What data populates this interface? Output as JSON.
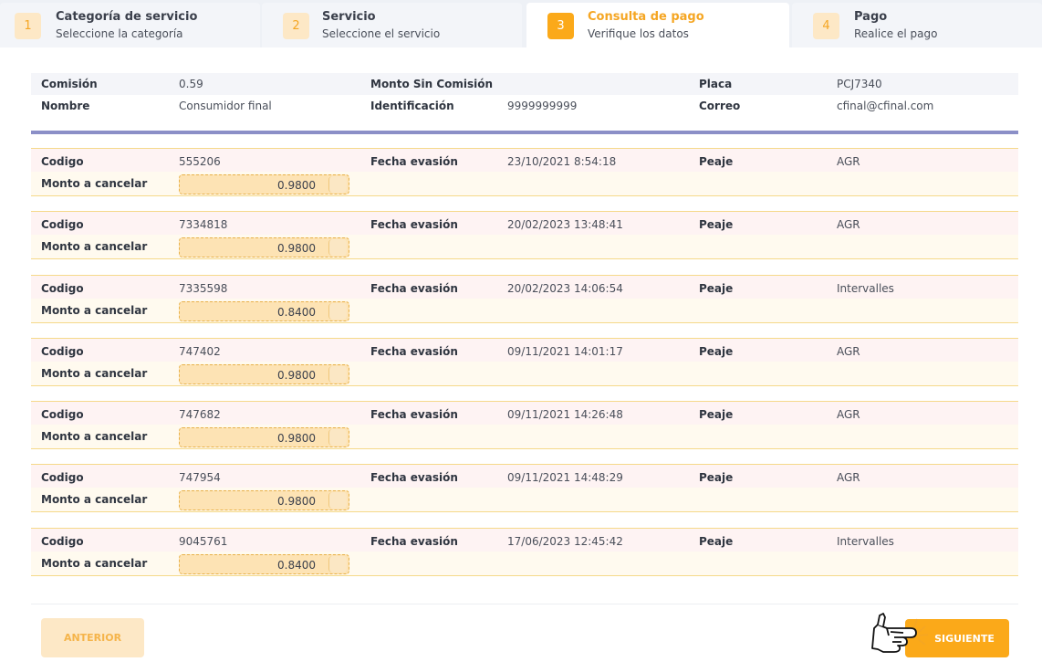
{
  "stepper": [
    {
      "number": "1",
      "title": "Categoría de servicio",
      "subtitle": "Seleccione la categoría"
    },
    {
      "number": "2",
      "title": "Servicio",
      "subtitle": "Seleccione el servicio"
    },
    {
      "number": "3",
      "title": "Consulta de pago",
      "subtitle": "Verifique los datos"
    },
    {
      "number": "4",
      "title": "Pago",
      "subtitle": "Realice el pago"
    }
  ],
  "summary": {
    "comision_label": "Comisión",
    "comision_value": "0.59",
    "monto_sin_label": "Monto Sin Comisión",
    "monto_sin_value": "",
    "placa_label": "Placa",
    "placa_value": "PCJ7340",
    "nombre_label": "Nombre",
    "nombre_value": "Consumidor final",
    "identificacion_label": "Identificación",
    "identificacion_value": "9999999999",
    "correo_label": "Correo",
    "correo_value": "cfinal@cfinal.com"
  },
  "labels": {
    "codigo": "Codigo",
    "fecha": "Fecha evasión",
    "peaje": "Peaje",
    "monto": "Monto a cancelar"
  },
  "items": [
    {
      "codigo": "555206",
      "fecha": "23/10/2021 8:54:18",
      "peaje": "AGR",
      "monto": "0.9800"
    },
    {
      "codigo": "7334818",
      "fecha": "20/02/2023 13:48:41",
      "peaje": "AGR",
      "monto": "0.9800"
    },
    {
      "codigo": "7335598",
      "fecha": "20/02/2023 14:06:54",
      "peaje": "Intervalles",
      "monto": "0.8400"
    },
    {
      "codigo": "747402",
      "fecha": "09/11/2021 14:01:17",
      "peaje": "AGR",
      "monto": "0.9800"
    },
    {
      "codigo": "747682",
      "fecha": "09/11/2021 14:26:48",
      "peaje": "AGR",
      "monto": "0.9800"
    },
    {
      "codigo": "747954",
      "fecha": "09/11/2021 14:48:29",
      "peaje": "AGR",
      "monto": "0.9800"
    },
    {
      "codigo": "9045761",
      "fecha": "17/06/2023 12:45:42",
      "peaje": "Intervalles",
      "monto": "0.8400"
    }
  ],
  "footer": {
    "prev_label": "ANTERIOR",
    "next_label": "SIGUIENTE"
  },
  "colors": {
    "accent": "#fba919",
    "divider": "#8b8fc7"
  }
}
